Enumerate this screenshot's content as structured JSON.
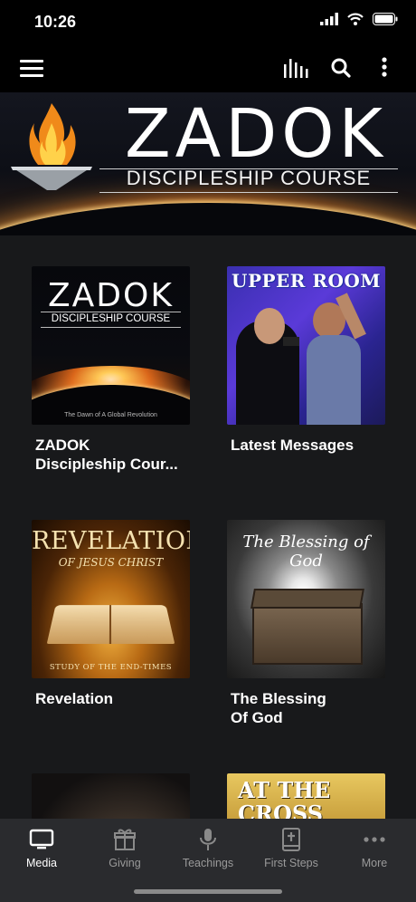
{
  "status_bar": {
    "time": "10:26"
  },
  "header": {
    "menu_icon": "hamburger-icon",
    "icons": [
      "equalizer-icon",
      "search-icon",
      "more-vertical-icon"
    ]
  },
  "banner": {
    "title": "ZADOK",
    "subtitle": "DISCIPLESHIP COURSE"
  },
  "grid": {
    "items": [
      {
        "label": "ZADOK\nDiscipleship Cour...",
        "line1": "ZADOK",
        "line2": "Discipleship Cour...",
        "thumb": {
          "title": "ZADOK",
          "subtitle": "DISCIPLESHIP COURSE",
          "tagline": "The Dawn of A Global Revolution"
        }
      },
      {
        "label": "Latest Messages",
        "line1": "Latest Messages",
        "line2": "",
        "thumb": {
          "title": "UPPER ROOM"
        }
      },
      {
        "label": "Revelation",
        "line1": "Revelation",
        "line2": "",
        "thumb": {
          "title": "REVELATION",
          "subtitle": "OF JESUS CHRIST",
          "footer": "STUDY OF THE END-TIMES"
        }
      },
      {
        "label": "The Blessing Of God",
        "line1": "The Blessing",
        "line2": "Of God",
        "thumb": {
          "title": "The Blessing of God"
        }
      },
      {
        "label": "",
        "line1": "",
        "line2": "",
        "thumb": {}
      },
      {
        "label": "",
        "line1": "",
        "line2": "",
        "thumb": {
          "title": "AT THE CROSS"
        }
      }
    ]
  },
  "tab_bar": {
    "tabs": [
      {
        "label": "Media",
        "icon": "tv-icon",
        "active": true
      },
      {
        "label": "Giving",
        "icon": "gift-icon",
        "active": false
      },
      {
        "label": "Teachings",
        "icon": "microphone-icon",
        "active": false
      },
      {
        "label": "First Steps",
        "icon": "bible-icon",
        "active": false
      },
      {
        "label": "More",
        "icon": "more-horizontal-icon",
        "active": false
      }
    ]
  }
}
